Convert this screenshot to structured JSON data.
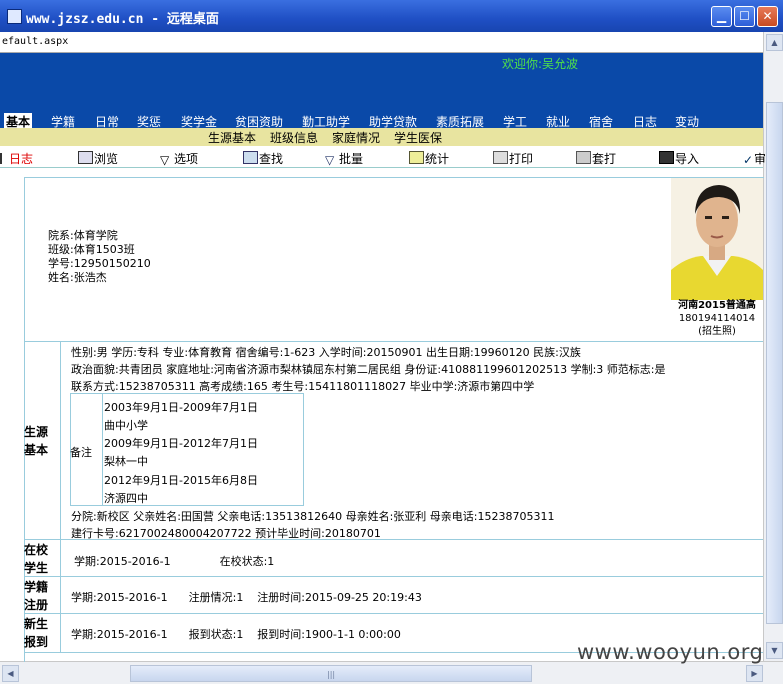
{
  "window": {
    "title": "www.jzsz.edu.cn - 远程桌面",
    "address": "efault.aspx",
    "minimize": "▁",
    "maximize": "☐",
    "close": "✕"
  },
  "header": {
    "welcome": "欢迎你:吴允波"
  },
  "main_nav": [
    "基本",
    "学籍",
    "日常",
    "奖惩",
    "奖学金",
    "贫困资助",
    "勤工助学",
    "助学贷款",
    "素质拓展",
    "学工",
    "就业",
    "宿舍",
    "日志",
    "变动"
  ],
  "sub_nav": [
    "生源基本",
    "班级信息",
    "家庭情况",
    "学生医保"
  ],
  "toolbar": [
    "日志",
    "浏览",
    "选项",
    "查找",
    "批量",
    "统计",
    "打印",
    "套打",
    "导入",
    "审"
  ],
  "student_header": {
    "dept": "院系:体育学院",
    "class": "班级:体育1503班",
    "sid": "学号:12950150210",
    "name": "姓名:张浩杰"
  },
  "photo": {
    "caption1": "河南2015普通高",
    "caption2": "180194114014",
    "caption3": "(招生照)"
  },
  "source": {
    "label1": "生源",
    "label2": "基本",
    "row1": "性别:男    学历:专科    专业:体育教育    宿舍编号:1-623    入学时间:20150901    出生日期:19960120    民族:汉族",
    "row2": "政治面貌:共青团员    家庭地址:河南省济源市梨林镇屈东村第二居民组    身份证:410881199601202513    学制:3    师范标志:是",
    "row3": "联系方式:15238705311    高考成绩:165    考生号:15411801118027    毕业中学:济源市第四中学",
    "remarks_label": "备注",
    "remarks": [
      "2003年9月1日-2009年7月1日",
      "曲中小学",
      "2009年9月1日-2012年7月1日",
      "梨林一中",
      "2012年9月1日-2015年6月8日",
      "济源四中"
    ],
    "row4": "分院:新校区    父亲姓名:田国营    父亲电话:13513812640    母亲姓名:张亚利    母亲电话:15238705311",
    "row5": "建行卡号:6217002480004207722    预计毕业时间:20180701"
  },
  "enrolled": {
    "label1": "在校",
    "label2": "学生",
    "text": "学期:2015-2016-1              在校状态:1"
  },
  "registered": {
    "label1": "学籍",
    "label2": "注册",
    "text": "学期:2015-2016-1      注册情况:1    注册时间:2015-09-25 20:19:43"
  },
  "newcomer": {
    "label1": "新生",
    "label2": "报到",
    "text": "学期:2015-2016-1      报到状态:1    报到时间:1900-1-1 0:00:00"
  },
  "watermark": "www.wooyun.org"
}
